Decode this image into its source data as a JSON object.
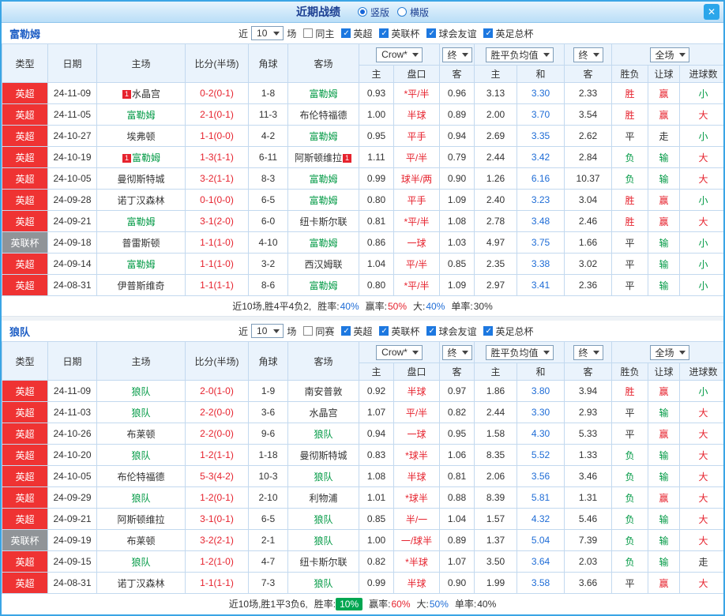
{
  "titlebar": {
    "title": "近期战绩",
    "radio_vertical": "竖版",
    "radio_horizontal": "横版",
    "vertical_checked": true,
    "horizontal_checked": false,
    "close_icon": "✕"
  },
  "controls": {
    "near_label": "近",
    "near_value": "10",
    "games_label": "场",
    "crow_select": "Crow*",
    "final_select": "终",
    "mean_select": "胜平负均值",
    "final_select2": "终",
    "fullmatch_select": "全场"
  },
  "table_headers": {
    "type": "类型",
    "date": "日期",
    "home": "主场",
    "score": "比分(半场)",
    "corner": "角球",
    "away": "客场",
    "odds_home": "主",
    "handicap": "盘口",
    "odds_away": "客",
    "mean_home": "主",
    "mean_draw": "和",
    "mean_away": "客",
    "result": "胜负",
    "handicap_result": "让球",
    "goals": "进球数"
  },
  "colors": {
    "win_red": "#e6232e",
    "lose_green": "#009944",
    "value_blue": "#1e6cd6",
    "league_red": "#ef3333",
    "cup_gray": "#909498",
    "badge_green": "#00a651"
  },
  "sections": [
    {
      "team": "富勒姆",
      "same_filter": {
        "label": "同主",
        "checked": false
      },
      "league_filters": [
        {
          "label": "英超",
          "checked": true
        },
        {
          "label": "英联杯",
          "checked": true
        },
        {
          "label": "球会友谊",
          "checked": true
        },
        {
          "label": "英足总杯",
          "checked": true
        }
      ],
      "rows": [
        {
          "league": "英超",
          "date": "24-11-09",
          "home": {
            "name": "水晶宫",
            "featured": false,
            "mark": "1",
            "mark_pos": "before"
          },
          "score": "0-2(0-1)",
          "corner": "1-8",
          "away": {
            "name": "富勒姆",
            "featured": true
          },
          "odds": [
            "0.93",
            "*平/半",
            "0.96"
          ],
          "mean": [
            "3.13",
            "3.30",
            "2.33"
          ],
          "result": "胜",
          "handicap_result": "赢",
          "goals": "小"
        },
        {
          "league": "英超",
          "date": "24-11-05",
          "home": {
            "name": "富勒姆",
            "featured": true
          },
          "score": "2-1(0-1)",
          "corner": "11-3",
          "away": {
            "name": "布伦特福德",
            "featured": false
          },
          "odds": [
            "1.00",
            "半球",
            "0.89"
          ],
          "mean": [
            "2.00",
            "3.70",
            "3.54"
          ],
          "result": "胜",
          "handicap_result": "赢",
          "goals": "大"
        },
        {
          "league": "英超",
          "date": "24-10-27",
          "home": {
            "name": "埃弗顿",
            "featured": false
          },
          "score": "1-1(0-0)",
          "corner": "4-2",
          "away": {
            "name": "富勒姆",
            "featured": true
          },
          "odds": [
            "0.95",
            "平手",
            "0.94"
          ],
          "mean": [
            "2.69",
            "3.35",
            "2.62"
          ],
          "result": "平",
          "handicap_result": "走",
          "goals": "小"
        },
        {
          "league": "英超",
          "date": "24-10-19",
          "home": {
            "name": "富勒姆",
            "featured": true,
            "mark": "1",
            "mark_pos": "before"
          },
          "score": "1-3(1-1)",
          "corner": "6-11",
          "away": {
            "name": "阿斯顿维拉",
            "featured": false,
            "mark": "1",
            "mark_pos": "after"
          },
          "odds": [
            "1.11",
            "平/半",
            "0.79"
          ],
          "mean": [
            "2.44",
            "3.42",
            "2.84"
          ],
          "result": "负",
          "handicap_result": "输",
          "goals": "大"
        },
        {
          "league": "英超",
          "date": "24-10-05",
          "home": {
            "name": "曼彻斯特城",
            "featured": false
          },
          "score": "3-2(1-1)",
          "corner": "8-3",
          "away": {
            "name": "富勒姆",
            "featured": true
          },
          "odds": [
            "0.99",
            "球半/两",
            "0.90"
          ],
          "mean": [
            "1.26",
            "6.16",
            "10.37"
          ],
          "result": "负",
          "handicap_result": "输",
          "goals": "大"
        },
        {
          "league": "英超",
          "date": "24-09-28",
          "home": {
            "name": "诺丁汉森林",
            "featured": false
          },
          "score": "0-1(0-0)",
          "corner": "6-5",
          "away": {
            "name": "富勒姆",
            "featured": true
          },
          "odds": [
            "0.80",
            "平手",
            "1.09"
          ],
          "mean": [
            "2.40",
            "3.23",
            "3.04"
          ],
          "result": "胜",
          "handicap_result": "赢",
          "goals": "小"
        },
        {
          "league": "英超",
          "date": "24-09-21",
          "home": {
            "name": "富勒姆",
            "featured": true
          },
          "score": "3-1(2-0)",
          "corner": "6-0",
          "away": {
            "name": "纽卡斯尔联",
            "featured": false
          },
          "odds": [
            "0.81",
            "*平/半",
            "1.08"
          ],
          "mean": [
            "2.78",
            "3.48",
            "2.46"
          ],
          "result": "胜",
          "handicap_result": "赢",
          "goals": "大"
        },
        {
          "league": "英联杯",
          "date": "24-09-18",
          "home": {
            "name": "普雷斯顿",
            "featured": false
          },
          "score": "1-1(1-0)",
          "corner": "4-10",
          "away": {
            "name": "富勒姆",
            "featured": true
          },
          "odds": [
            "0.86",
            "一球",
            "1.03"
          ],
          "mean": [
            "4.97",
            "3.75",
            "1.66"
          ],
          "result": "平",
          "handicap_result": "输",
          "goals": "小"
        },
        {
          "league": "英超",
          "date": "24-09-14",
          "home": {
            "name": "富勒姆",
            "featured": true
          },
          "score": "1-1(1-0)",
          "corner": "3-2",
          "away": {
            "name": "西汉姆联",
            "featured": false
          },
          "odds": [
            "1.04",
            "平/半",
            "0.85"
          ],
          "mean": [
            "2.35",
            "3.38",
            "3.02"
          ],
          "result": "平",
          "handicap_result": "输",
          "goals": "小"
        },
        {
          "league": "英超",
          "date": "24-08-31",
          "home": {
            "name": "伊普斯维奇",
            "featured": false
          },
          "score": "1-1(1-1)",
          "corner": "8-6",
          "away": {
            "name": "富勒姆",
            "featured": true
          },
          "odds": [
            "0.80",
            "*平/半",
            "1.09"
          ],
          "mean": [
            "2.97",
            "3.41",
            "2.36"
          ],
          "result": "平",
          "handicap_result": "输",
          "goals": "小"
        }
      ],
      "summary": {
        "prefix": "近10场,胜4平4负2,",
        "win_label": "胜率:",
        "win_value": "40%",
        "win_badge": false,
        "cover_label": "赢率:",
        "cover_value": "50%",
        "big_label": "大:",
        "big_value": "40%",
        "odd_label": "单率:",
        "odd_value": "30%"
      }
    },
    {
      "team": "狼队",
      "same_filter": {
        "label": "同赛",
        "checked": false
      },
      "league_filters": [
        {
          "label": "英超",
          "checked": true
        },
        {
          "label": "英联杯",
          "checked": true
        },
        {
          "label": "球会友谊",
          "checked": true
        },
        {
          "label": "英足总杯",
          "checked": true
        }
      ],
      "rows": [
        {
          "league": "英超",
          "date": "24-11-09",
          "home": {
            "name": "狼队",
            "featured": true
          },
          "score": "2-0(1-0)",
          "corner": "1-9",
          "away": {
            "name": "南安普敦",
            "featured": false
          },
          "odds": [
            "0.92",
            "半球",
            "0.97"
          ],
          "mean": [
            "1.86",
            "3.80",
            "3.94"
          ],
          "result": "胜",
          "handicap_result": "赢",
          "goals": "小"
        },
        {
          "league": "英超",
          "date": "24-11-03",
          "home": {
            "name": "狼队",
            "featured": true
          },
          "score": "2-2(0-0)",
          "corner": "3-6",
          "away": {
            "name": "水晶宫",
            "featured": false
          },
          "odds": [
            "1.07",
            "平/半",
            "0.82"
          ],
          "mean": [
            "2.44",
            "3.30",
            "2.93"
          ],
          "result": "平",
          "handicap_result": "输",
          "goals": "大"
        },
        {
          "league": "英超",
          "date": "24-10-26",
          "home": {
            "name": "布莱顿",
            "featured": false
          },
          "score": "2-2(0-0)",
          "corner": "9-6",
          "away": {
            "name": "狼队",
            "featured": true
          },
          "odds": [
            "0.94",
            "一球",
            "0.95"
          ],
          "mean": [
            "1.58",
            "4.30",
            "5.33"
          ],
          "result": "平",
          "handicap_result": "赢",
          "goals": "大"
        },
        {
          "league": "英超",
          "date": "24-10-20",
          "home": {
            "name": "狼队",
            "featured": true
          },
          "score": "1-2(1-1)",
          "corner": "1-18",
          "away": {
            "name": "曼彻斯特城",
            "featured": false
          },
          "odds": [
            "0.83",
            "*球半",
            "1.06"
          ],
          "mean": [
            "8.35",
            "5.52",
            "1.33"
          ],
          "result": "负",
          "handicap_result": "输",
          "goals": "大"
        },
        {
          "league": "英超",
          "date": "24-10-05",
          "home": {
            "name": "布伦特福德",
            "featured": false
          },
          "score": "5-3(4-2)",
          "corner": "10-3",
          "away": {
            "name": "狼队",
            "featured": true
          },
          "odds": [
            "1.08",
            "半球",
            "0.81"
          ],
          "mean": [
            "2.06",
            "3.56",
            "3.46"
          ],
          "result": "负",
          "handicap_result": "输",
          "goals": "大"
        },
        {
          "league": "英超",
          "date": "24-09-29",
          "home": {
            "name": "狼队",
            "featured": true
          },
          "score": "1-2(0-1)",
          "corner": "2-10",
          "away": {
            "name": "利物浦",
            "featured": false
          },
          "odds": [
            "1.01",
            "*球半",
            "0.88"
          ],
          "mean": [
            "8.39",
            "5.81",
            "1.31"
          ],
          "result": "负",
          "handicap_result": "赢",
          "goals": "大"
        },
        {
          "league": "英超",
          "date": "24-09-21",
          "home": {
            "name": "阿斯顿维拉",
            "featured": false
          },
          "score": "3-1(0-1)",
          "corner": "6-5",
          "away": {
            "name": "狼队",
            "featured": true
          },
          "odds": [
            "0.85",
            "半/一",
            "1.04"
          ],
          "mean": [
            "1.57",
            "4.32",
            "5.46"
          ],
          "result": "负",
          "handicap_result": "输",
          "goals": "大"
        },
        {
          "league": "英联杯",
          "date": "24-09-19",
          "home": {
            "name": "布莱顿",
            "featured": false
          },
          "score": "3-2(2-1)",
          "corner": "2-1",
          "away": {
            "name": "狼队",
            "featured": true
          },
          "odds": [
            "1.00",
            "一/球半",
            "0.89"
          ],
          "mean": [
            "1.37",
            "5.04",
            "7.39"
          ],
          "result": "负",
          "handicap_result": "输",
          "goals": "大"
        },
        {
          "league": "英超",
          "date": "24-09-15",
          "home": {
            "name": "狼队",
            "featured": true
          },
          "score": "1-2(1-0)",
          "corner": "4-7",
          "away": {
            "name": "纽卡斯尔联",
            "featured": false
          },
          "odds": [
            "0.82",
            "*半球",
            "1.07"
          ],
          "mean": [
            "3.50",
            "3.64",
            "2.03"
          ],
          "result": "负",
          "handicap_result": "输",
          "goals": "走"
        },
        {
          "league": "英超",
          "date": "24-08-31",
          "home": {
            "name": "诺丁汉森林",
            "featured": false
          },
          "score": "1-1(1-1)",
          "corner": "7-3",
          "away": {
            "name": "狼队",
            "featured": true
          },
          "odds": [
            "0.99",
            "半球",
            "0.90"
          ],
          "mean": [
            "1.99",
            "3.58",
            "3.66"
          ],
          "result": "平",
          "handicap_result": "赢",
          "goals": "大"
        }
      ],
      "summary": {
        "prefix": "近10场,胜1平3负6,",
        "win_label": "胜率:",
        "win_value": "10%",
        "win_badge": true,
        "cover_label": "赢率:",
        "cover_value": "60%",
        "big_label": "大:",
        "big_value": "50%",
        "odd_label": "单率:",
        "odd_value": "40%"
      }
    }
  ]
}
